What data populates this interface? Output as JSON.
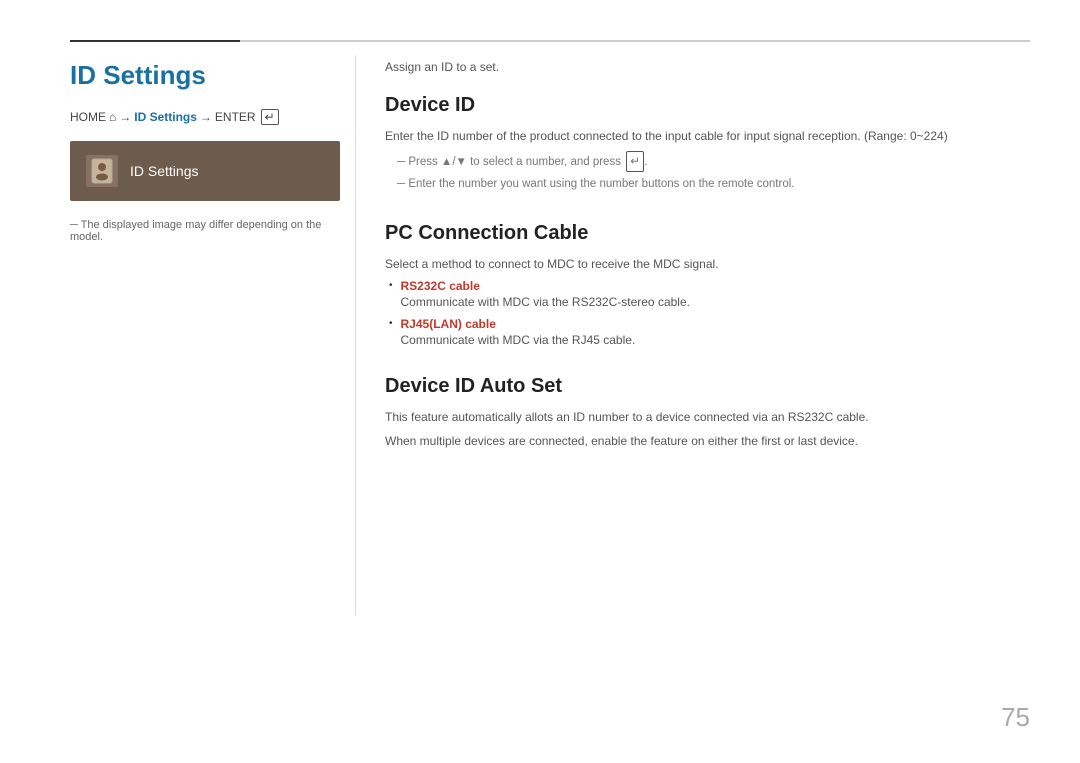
{
  "page": {
    "title": "ID Settings",
    "page_number": "75"
  },
  "breadcrumb": {
    "home": "HOME",
    "home_icon": "⌂",
    "arrow1": "→",
    "id_settings": "ID Settings",
    "arrow2": "→",
    "enter": "ENTER",
    "enter_icon": "↵"
  },
  "menu_item": {
    "label": "ID Settings",
    "icon": "🪪"
  },
  "left_note": "The displayed image may differ depending on the model.",
  "right": {
    "assign_text": "Assign an ID to a set.",
    "sections": [
      {
        "id": "device-id",
        "title": "Device ID",
        "desc": "Enter the ID number of the product connected to the input cable for input signal reception. (Range: 0~224)",
        "notes": [
          "Press ▲/▼ to select a number, and press ↵.",
          "Enter the number you want using the number buttons on the remote control."
        ]
      },
      {
        "id": "pc-connection",
        "title": "PC Connection Cable",
        "desc": "Select a method to connect to MDC to receive the MDC signal.",
        "bullets": [
          {
            "label": "RS232C cable",
            "desc": "Communicate with MDC via the RS232C-stereo cable."
          },
          {
            "label": "RJ45(LAN) cable",
            "desc": "Communicate with MDC via the RJ45 cable."
          }
        ]
      },
      {
        "id": "device-id-auto-set",
        "title": "Device ID Auto Set",
        "desc": "This feature automatically allots an ID number to a device connected via an RS232C cable.",
        "desc2": "When multiple devices are connected, enable the feature on either the first or last device."
      }
    ]
  }
}
